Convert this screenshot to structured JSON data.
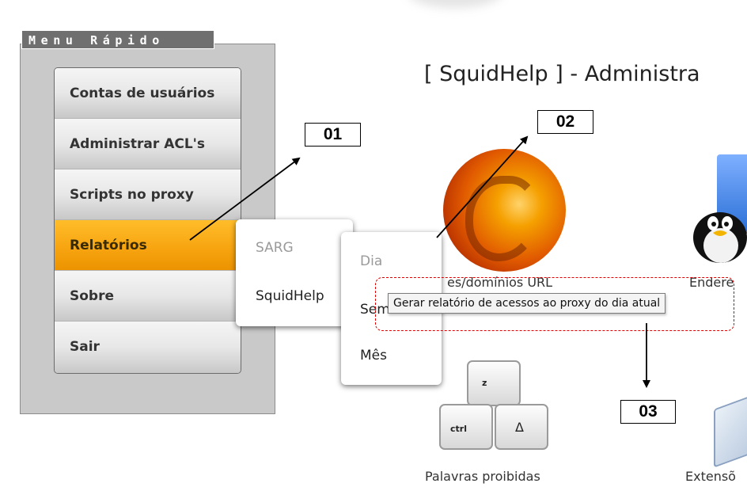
{
  "quick_menu": {
    "title": "Menu Rápido",
    "items": [
      {
        "label": "Contas de usuários"
      },
      {
        "label": "Administrar ACL's"
      },
      {
        "label": "Scripts no proxy"
      },
      {
        "label": "Relatórios",
        "active": true
      },
      {
        "label": "Sobre"
      },
      {
        "label": "Sair"
      }
    ]
  },
  "submenu_reports": {
    "items": [
      {
        "label": "SARG",
        "disabled": true
      },
      {
        "label": "SquidHelp",
        "disabled": false
      }
    ]
  },
  "submenu_squidhelp": {
    "items": [
      {
        "label": "Dia",
        "disabled": true
      },
      {
        "label": "Sem",
        "disabled": false
      },
      {
        "label": "Mês",
        "disabled": false
      }
    ]
  },
  "page": {
    "title": "[ SquidHelp ] - Administra"
  },
  "icons": [
    {
      "icon": "firefox-icon",
      "caption": "es/domínios URL"
    },
    {
      "icon": "tux-icon",
      "caption": "Endere"
    },
    {
      "icon": "keyboard-keys-icon",
      "caption": "Palavras proibidas",
      "key_labels": [
        "z",
        "ctrl",
        "Δ"
      ]
    },
    {
      "icon": "extension-icon",
      "caption": "Extensõ"
    }
  ],
  "tooltip": {
    "text": "Gerar relatório de acessos ao proxy do dia atual"
  },
  "annotations": {
    "callout_01": "01",
    "callout_02": "02",
    "callout_03": "03",
    "highlight_color": "#e00000",
    "arrow_color": "#000000"
  },
  "colors": {
    "active_item": "#f7a511",
    "panel_bg": "#c9c9c9",
    "title_bg": "#6f6f6f"
  }
}
